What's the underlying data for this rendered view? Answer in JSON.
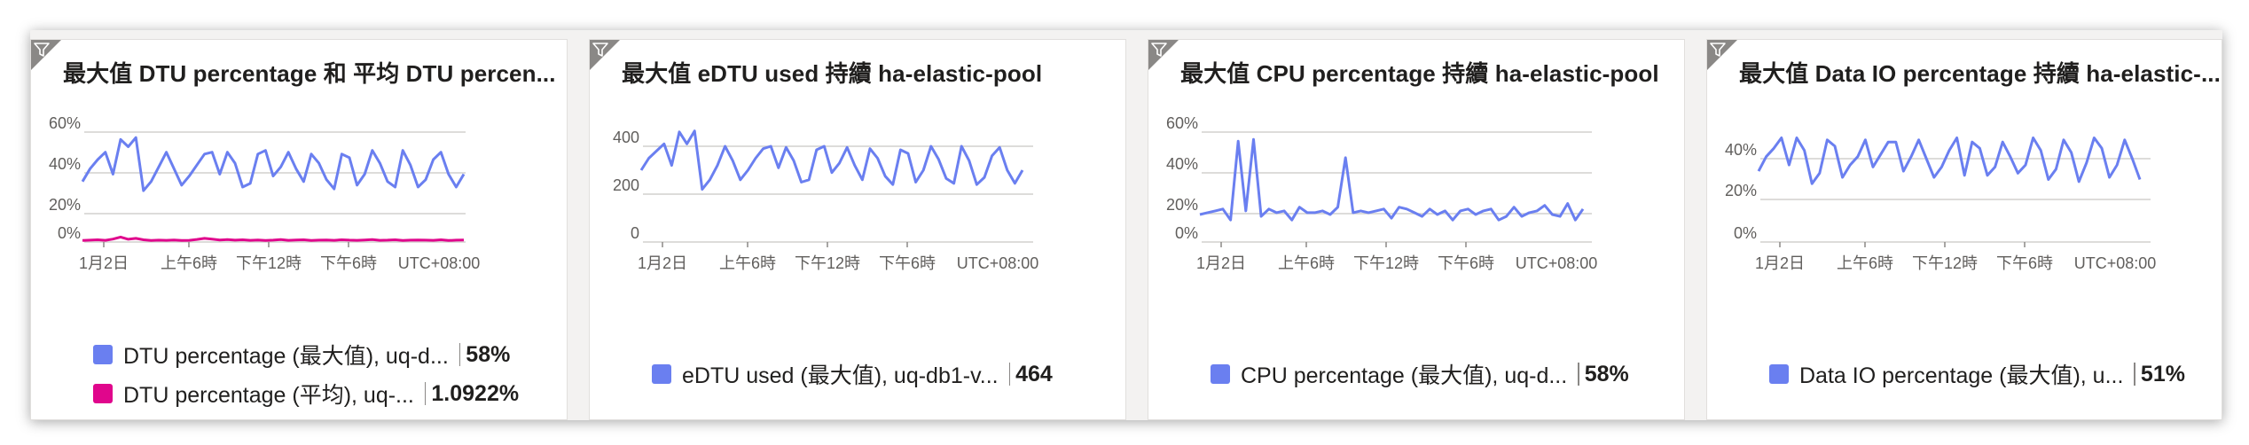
{
  "colors": {
    "blue": "#6a7ff0",
    "magenta": "#e0068c"
  },
  "tiles": [
    {
      "title": "最大值 DTU percentage 和 平均 DTU percen...",
      "icon": "filter-icon",
      "y_ticks": [
        "60%",
        "40%",
        "20%",
        "0%"
      ],
      "x_ticks": [
        "1月2日",
        "上午6時",
        "下午12時",
        "下午6時",
        "UTC+08:00"
      ],
      "legend": [
        {
          "label": "DTU percentage (最大值), uq-d...",
          "value": "58%",
          "color": "#6a7ff0"
        },
        {
          "label": "DTU percentage (平均), uq-...",
          "value": "1.0922%",
          "color": "#e0068c"
        }
      ]
    },
    {
      "title": "最大值 eDTU used 持續 ha-elastic-pool",
      "icon": "filter-icon",
      "y_ticks": [
        "400",
        "200",
        "0"
      ],
      "x_ticks": [
        "1月2日",
        "上午6時",
        "下午12時",
        "下午6時",
        "UTC+08:00"
      ],
      "legend": [
        {
          "label": "eDTU used (最大值), uq-db1-v...",
          "value": "464",
          "color": "#6a7ff0"
        }
      ]
    },
    {
      "title": "最大值 CPU percentage 持續 ha-elastic-pool",
      "icon": "filter-icon",
      "y_ticks": [
        "60%",
        "40%",
        "20%",
        "0%"
      ],
      "x_ticks": [
        "1月2日",
        "上午6時",
        "下午12時",
        "下午6時",
        "UTC+08:00"
      ],
      "legend": [
        {
          "label": "CPU percentage (最大值), uq-d...",
          "value": "58%",
          "color": "#6a7ff0"
        }
      ]
    },
    {
      "title": "最大值 Data IO percentage 持續 ha-elastic-...",
      "icon": "filter-icon",
      "y_ticks": [
        "40%",
        "20%",
        "0%"
      ],
      "x_ticks": [
        "1月2日",
        "上午6時",
        "下午12時",
        "下午6時",
        "UTC+08:00"
      ],
      "legend": [
        {
          "label": "Data IO percentage (最大值), u...",
          "value": "51%",
          "color": "#6a7ff0"
        }
      ]
    }
  ],
  "chart_data": [
    {
      "type": "line",
      "title": "最大值 DTU percentage 和 平均 DTU percen...",
      "ylim": [
        0,
        60
      ],
      "series": [
        {
          "name": "DTU percentage (最大值), uq-d...",
          "values": [
            33,
            40,
            45,
            49,
            37,
            56,
            52,
            57,
            28,
            33,
            41,
            49,
            40,
            31,
            36,
            42,
            48,
            49,
            37,
            49,
            43,
            30,
            32,
            48,
            50,
            36,
            41,
            49,
            40,
            33,
            48,
            43,
            34,
            29,
            48,
            46,
            31,
            37,
            50,
            43,
            33,
            30,
            50,
            42,
            30,
            34,
            45,
            49,
            37,
            30,
            37
          ]
        },
        {
          "name": "DTU percentage (平均), uq-...",
          "values": [
            0.8,
            1.0,
            1.2,
            0.9,
            1.6,
            2.7,
            1.5,
            2.0,
            1.2,
            0.8,
            1.0,
            0.9,
            1.1,
            0.8,
            0.9,
            1.4,
            2.0,
            1.6,
            1.1,
            1.3,
            1.0,
            1.2,
            0.9,
            1.1,
            0.8,
            1.0,
            1.3,
            0.9,
            1.1,
            1.2,
            0.8,
            1.0,
            1.1,
            0.9,
            1.2,
            1.0,
            0.9,
            1.1,
            1.3,
            0.9,
            1.0,
            1.2,
            0.8,
            1.0,
            1.1,
            1.0,
            0.9,
            1.2,
            0.8,
            1.0,
            1.1
          ]
        }
      ]
    },
    {
      "type": "line",
      "title": "最大值 eDTU used 持續 ha-elastic-pool",
      "ylim": [
        0,
        500
      ],
      "series": [
        {
          "name": "eDTU used (最大值), uq-db1-v...",
          "values": [
            300,
            350,
            380,
            410,
            320,
            460,
            410,
            464,
            220,
            260,
            320,
            400,
            340,
            260,
            300,
            350,
            390,
            400,
            310,
            395,
            340,
            250,
            260,
            385,
            400,
            290,
            330,
            395,
            320,
            260,
            390,
            350,
            275,
            240,
            385,
            370,
            250,
            300,
            400,
            345,
            265,
            245,
            400,
            340,
            240,
            270,
            360,
            395,
            300,
            245,
            300
          ]
        }
      ]
    },
    {
      "type": "line",
      "title": "最大值 CPU percentage 持續 ha-elastic-pool",
      "ylim": [
        0,
        60
      ],
      "series": [
        {
          "name": "CPU percentage (最大值), uq-d...",
          "values": [
            15,
            16,
            17,
            18,
            12,
            55,
            17,
            56,
            14,
            18,
            16,
            17,
            12,
            19,
            16,
            16,
            17,
            15,
            19,
            46,
            16,
            17,
            16,
            17,
            18,
            13,
            19,
            18,
            16,
            14,
            18,
            15,
            17,
            12,
            17,
            18,
            15,
            17,
            18,
            12,
            14,
            19,
            14,
            16,
            17,
            20,
            15,
            14,
            21,
            12,
            18
          ]
        }
      ]
    },
    {
      "type": "line",
      "title": "最大值 Data IO percentage 持續 ha-elastic-...",
      "ylim": [
        0,
        60
      ],
      "series": [
        {
          "name": "Data IO percentage (最大值), u...",
          "values": [
            34,
            41,
            45,
            50,
            37,
            50,
            44,
            28,
            33,
            49,
            46,
            31,
            37,
            41,
            49,
            36,
            42,
            48,
            48,
            34,
            41,
            49,
            40,
            31,
            36,
            44,
            50,
            32,
            48,
            45,
            32,
            36,
            48,
            41,
            33,
            37,
            50,
            44,
            30,
            35,
            49,
            43,
            29,
            38,
            50,
            45,
            31,
            37,
            49,
            40,
            30
          ]
        }
      ]
    }
  ]
}
